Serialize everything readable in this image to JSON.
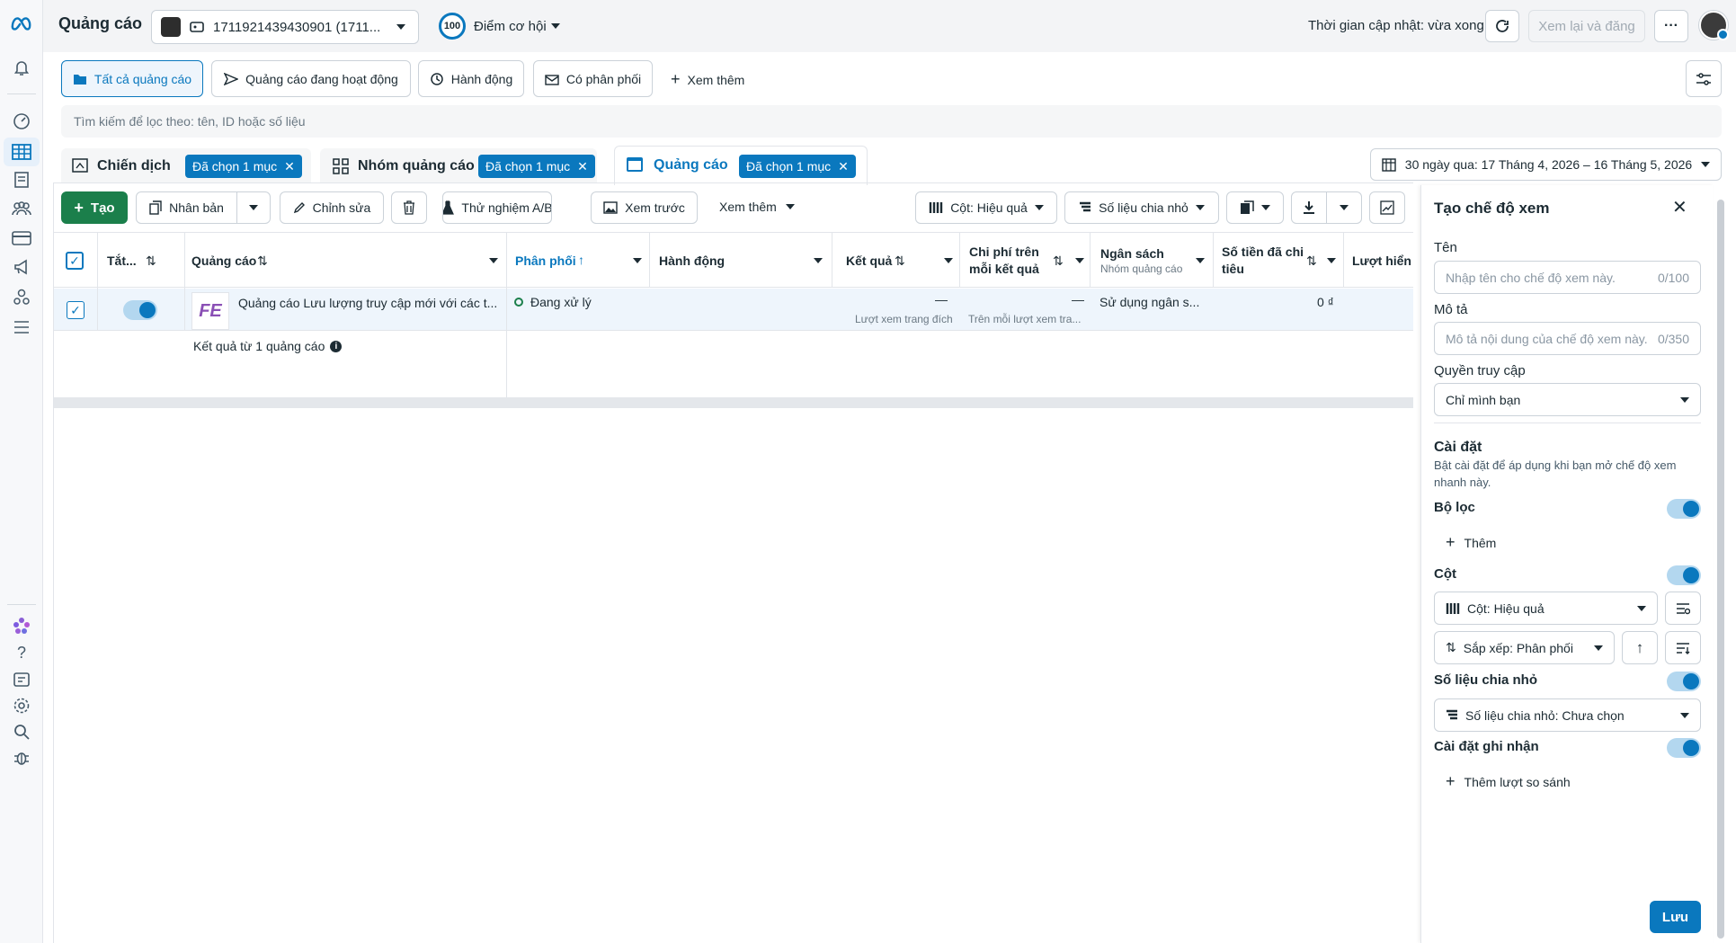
{
  "brand": {
    "logo": "meta-logo",
    "title": "Quảng cáo"
  },
  "account": {
    "id_text": "1711921439430901 (1711..."
  },
  "opportunity": {
    "score": "100",
    "label": "Điểm cơ hội"
  },
  "topbar": {
    "updated_text": "Thời gian cập nhật: vừa xong",
    "review_publish": "Xem lại và đăng",
    "more": "···"
  },
  "filters": {
    "all_ads": "Tất cả quảng cáo",
    "active_ads": "Quảng cáo đang hoạt động",
    "actions": "Hành động",
    "delivering": "Có phân phối",
    "see_more": "Xem thêm"
  },
  "search": {
    "placeholder": "Tìm kiếm để lọc theo: tên, ID hoặc số liệu"
  },
  "levels": {
    "campaign": "Chiến dịch",
    "campaign_chip": "Đã chọn 1 mục",
    "adset": "Nhóm quảng cáo",
    "adset_chip": "Đã chọn 1 mục",
    "ad": "Quảng cáo",
    "ad_chip": "Đã chọn 1 mục"
  },
  "date_range": "30 ngày qua: 17 Tháng 4, 2026 – 16 Tháng 5, 2026",
  "toolbar": {
    "create": "Tạo",
    "duplicate": "Nhân bản",
    "edit": "Chỉnh sửa",
    "ab_test": "Thử nghiệm A/B",
    "preview": "Xem trước",
    "more": "Xem thêm",
    "columns": "Cột: Hiệu quả",
    "breakdown": "Số liệu chia nhỏ"
  },
  "table": {
    "headers": {
      "all": "Tắt...",
      "ad": "Quảng cáo",
      "delivery": "Phân phối",
      "actions": "Hành động",
      "results": "Kết quả",
      "cost_per_result_1": "Chi phí trên",
      "cost_per_result_2": "mỗi kết quả",
      "budget": "Ngân sách",
      "budget_sub": "Nhóm quảng cáo",
      "spent_1": "Số tiền đã chi",
      "spent_2": "tiêu",
      "impressions": "Lượt hiển"
    },
    "row": {
      "thumb_text": "FE",
      "name": "Quảng cáo Lưu lượng truy cập mới với các t...",
      "delivery": "Đang xử lý",
      "results": "—",
      "results_sub": "Lượt xem trang đích",
      "cost": "—",
      "cost_sub": "Trên mỗi lượt xem tra...",
      "budget": "Sử dụng ngân s...",
      "spent": "0 ₫"
    },
    "summary": "Kết quả từ 1 quảng cáo"
  },
  "panel": {
    "title": "Tạo chế độ xem",
    "name_label": "Tên",
    "name_placeholder": "Nhập tên cho chế độ xem này.",
    "name_count": "0/100",
    "desc_label": "Mô tả",
    "desc_placeholder": "Mô tả nội dung của chế độ xem này.",
    "desc_count": "0/350",
    "access_label": "Quyền truy cập",
    "access_value": "Chỉ mình bạn",
    "settings_title": "Cài đặt",
    "settings_desc": "Bật cài đặt để áp dụng khi bạn mở chế độ xem nhanh này.",
    "filters_label": "Bộ lọc",
    "add_filter": "Thêm",
    "columns_label": "Cột",
    "columns_value": "Cột: Hiệu quả",
    "sort_value": "Sắp xếp: Phân phối",
    "breakdown_label": "Số liệu chia nhỏ",
    "breakdown_value": "Số liệu chia nhỏ: Chưa chọn",
    "attribution_label": "Cài đặt ghi nhận",
    "add_comparison": "Thêm lượt so sánh",
    "save": "Lưu"
  },
  "colors": {
    "primary": "#0a78be",
    "create_green": "#1b7f4b",
    "panel_bg": "#ffffff"
  }
}
